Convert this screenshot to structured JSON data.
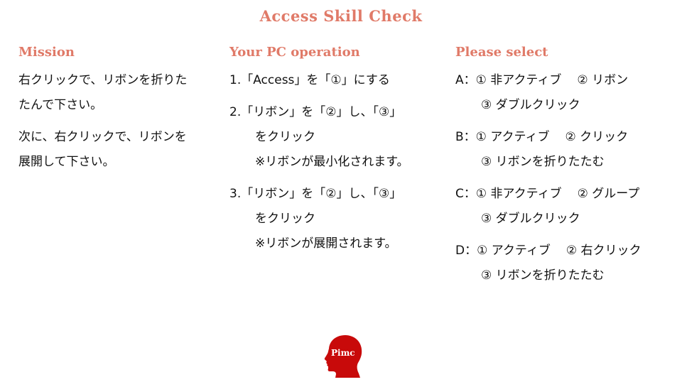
{
  "colors": {
    "accent": "#e07a68",
    "logo": "#c80a0a",
    "text": "#111111"
  },
  "title": "Access Skill Check",
  "mission": {
    "heading": "Mission",
    "paragraphs": [
      {
        "lines": [
          "右クリックで、リボンを折りた",
          "たんで下さい。"
        ]
      },
      {
        "lines": [
          "次に、右クリックで、リボンを",
          "展開して下さい。"
        ]
      }
    ]
  },
  "operation": {
    "heading": "Your PC operation",
    "steps": [
      {
        "lines": [
          "1.「Access」を「①」にする"
        ]
      },
      {
        "lines": [
          "2.「リボン」を「②」し、「③」",
          "をクリック",
          "※リボンが最小化されます。"
        ]
      },
      {
        "lines": [
          "3.「リボン」を「②」し、「③」",
          "をクリック",
          "※リボンが展開されます。"
        ]
      }
    ]
  },
  "select": {
    "heading": "Please select",
    "options": [
      {
        "label": "A：",
        "o1": "① 非アクティブ",
        "o2": "② リボン",
        "o3": "③ ダブルクリック"
      },
      {
        "label": "B：",
        "o1": "① アクティブ",
        "o2": "② クリック",
        "o3": "③ リボンを折りたたむ"
      },
      {
        "label": "C：",
        "o1": "① 非アクティブ",
        "o2": "② グループ",
        "o3": "③ ダブルクリック"
      },
      {
        "label": "D：",
        "o1": "① アクティブ",
        "o2": "② 右クリック",
        "o3": "③ リボンを折りたたむ"
      }
    ]
  },
  "logo": {
    "text": "Pimc",
    "icon": "head-silhouette-icon"
  }
}
